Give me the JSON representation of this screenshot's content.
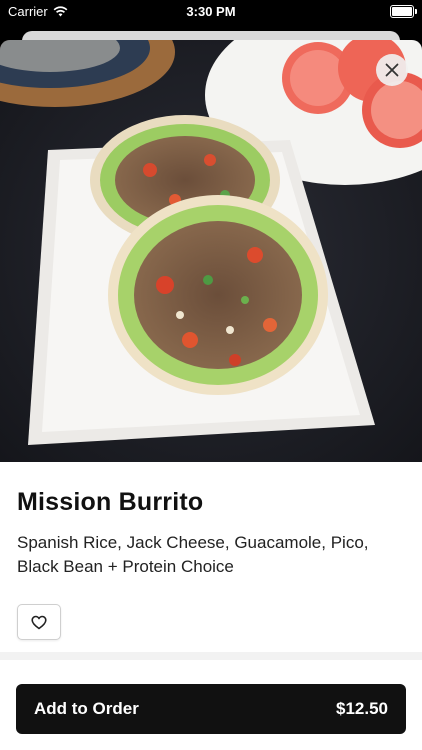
{
  "status_bar": {
    "carrier": "Carrier",
    "time": "3:30 PM",
    "wifi_icon": "wifi-icon",
    "battery_icon": "battery-icon",
    "battery_level": 1.0
  },
  "item": {
    "image": "burrito-photo",
    "title": "Mission Burrito",
    "description": "Spanish Rice, Jack Cheese, Guacamole, Pico, Black Bean + Protein Choice",
    "close_icon": "close-icon",
    "favorite_icon": "heart-icon"
  },
  "order": {
    "label": "Add to Order",
    "price": "$12.50"
  },
  "colors": {
    "button_bg": "#111111",
    "button_text": "#ffffff",
    "divider": "#f2f2f2"
  }
}
